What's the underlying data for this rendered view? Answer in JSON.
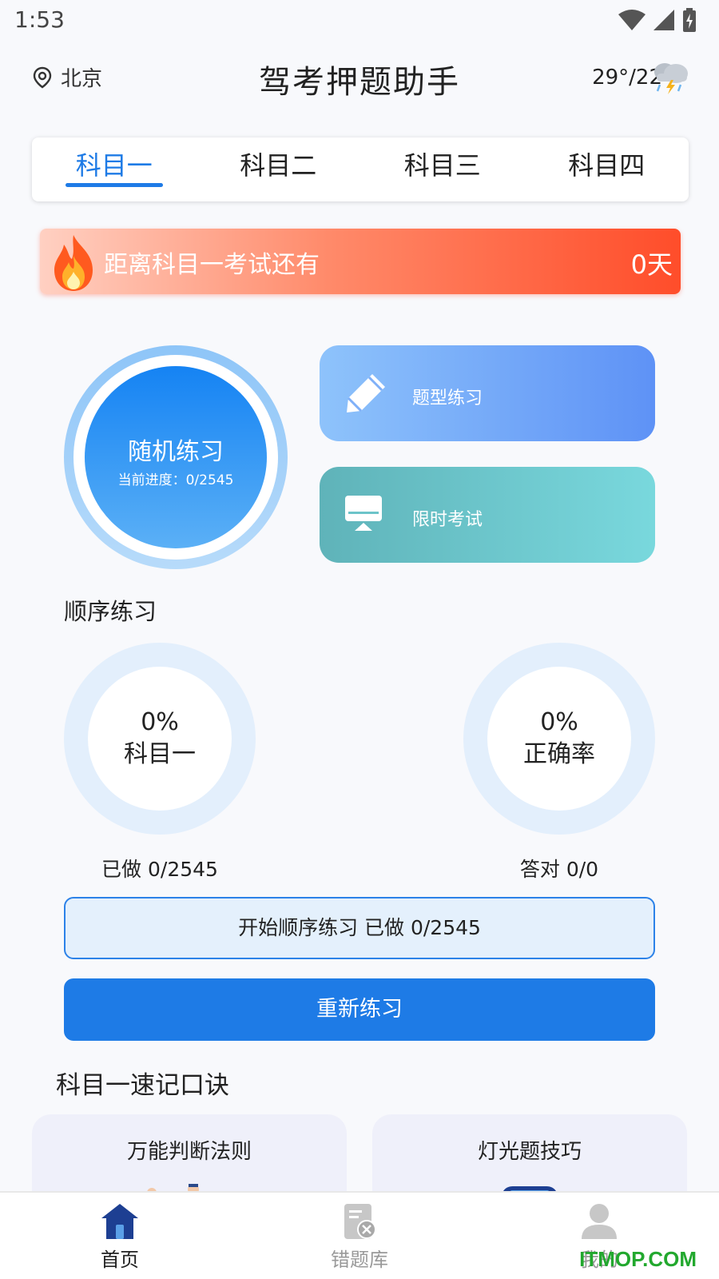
{
  "status_bar": {
    "time": "1:53"
  },
  "header": {
    "location": "北京",
    "title": "驾考押题助手",
    "weather": "29°/22°",
    "weather_icon": "thunderstorm-icon"
  },
  "tabs": [
    {
      "label": "科目一",
      "active": true
    },
    {
      "label": "科目二",
      "active": false
    },
    {
      "label": "科目三",
      "active": false
    },
    {
      "label": "科目四",
      "active": false
    }
  ],
  "countdown": {
    "text": "距离科目一考试还有",
    "days": "0天"
  },
  "random_practice": {
    "title": "随机练习",
    "progress": "当前进度：0/2545"
  },
  "actions": [
    {
      "label": "题型练习",
      "icon": "pencil-icon"
    },
    {
      "label": "限时考试",
      "icon": "monitor-icon"
    }
  ],
  "sequential": {
    "heading": "顺序练习",
    "left_ring": {
      "percent": "0%",
      "label": "科目一",
      "caption": "已做 0/2545"
    },
    "right_ring": {
      "percent": "0%",
      "label": "正确率",
      "caption": "答对 0/0"
    },
    "start_button": "开始顺序练习 已做 0/2545",
    "reset_button": "重新练习"
  },
  "tips": {
    "heading": "科目一速记口诀",
    "cards": [
      {
        "title": "万能判断法则"
      },
      {
        "title": "灯光题技巧"
      }
    ]
  },
  "bottom_nav": [
    {
      "label": "首页",
      "icon": "home-icon",
      "active": true
    },
    {
      "label": "错题库",
      "icon": "wrong-questions-icon",
      "active": false
    },
    {
      "label": "我的",
      "icon": "profile-icon",
      "active": false
    }
  ],
  "watermark": "ITMOP.COM",
  "colors": {
    "accent": "#1e7be6",
    "banner_end": "#ff4d2a",
    "ring_light": "#e3effc"
  }
}
